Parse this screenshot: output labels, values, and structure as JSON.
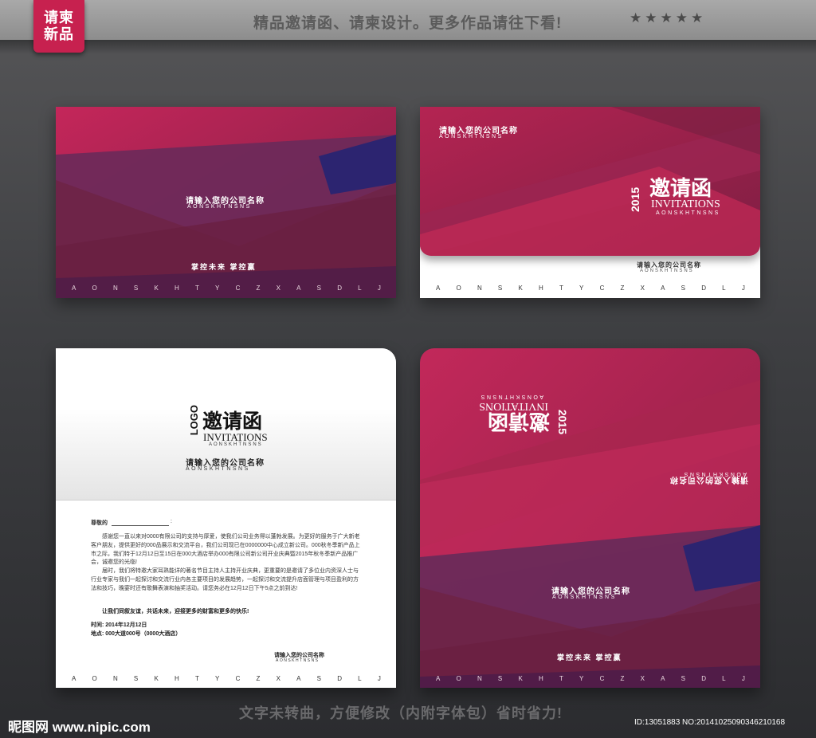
{
  "banner": {
    "badge_line1": "请柬",
    "badge_line2": "新品",
    "headline": "精品邀请函、请柬设计。更多作品请往下看!",
    "stars": "★★★★★"
  },
  "card_front": {
    "company": "请输入您的公司名称",
    "company_en": "AONSKHTNSNS",
    "slogan": "掌控未来  掌控赢",
    "letters": [
      "A",
      "O",
      "N",
      "S",
      "K",
      "H",
      "T",
      "Y",
      "C",
      "Z",
      "X",
      "A",
      "S",
      "D",
      "L",
      "J"
    ]
  },
  "card_back": {
    "company": "请输入您的公司名称",
    "company_en": "AONSKHTNSNS",
    "year": "2015",
    "title_zh": "邀请函",
    "title_en": "INVITATIONS",
    "title_sub": "AONSKHTNSNS",
    "letters": [
      "A",
      "O",
      "N",
      "S",
      "K",
      "H",
      "T",
      "Y",
      "C",
      "Z",
      "X",
      "A",
      "S",
      "D",
      "L",
      "J"
    ]
  },
  "card_inside": {
    "logo": "LOGO",
    "title_zh": "邀请函",
    "title_en": "INVITATIONS",
    "title_sub": "AONSKHTNSNS",
    "company": "请输入您的公司名称",
    "company_en": "AONSKHTNSNS",
    "greeting": "尊敬的",
    "greeting_colon": ":",
    "body_p1": "感谢您一直以来对0000有限公司的支持与厚爱，使我们公司业务得以蓬勃发展。为更好的服务于广大新老客户朋友，提供更好的000品展示和交流平台，我们公司现已在0000000中心成立新公司。000秋冬季新产品上市之际，我们特于12月12日至15日在000大酒店举办000有限公司新公司开业庆典暨2015年秋冬季新产品推广会，诚邀您的光临!",
    "body_p2": "届时，我们将特邀大家耳熟能详的著名节目主持人主持开业庆典，更重要的是邀请了多位业内资深人士与行业专家与我们一起探讨和交流行业内各主要项目的发展趋势，一起探讨和交流提升店面管理与项目盈利的方法和技巧，晚宴时还有歌舞表演和抽奖活动。请您务必在12月12日下午5点之前到达!",
    "closing": "让我们同叙友谊，共话未来，迎接更多的财富和更多的快乐!",
    "time": "时间: 2014年12月12日",
    "place": "地点: 000大道000号（0000大酒店）",
    "signature": "请输入您的公司名称",
    "signature_en": "AONSKHTNSNS",
    "letters": [
      "A",
      "O",
      "N",
      "S",
      "K",
      "H",
      "T",
      "Y",
      "C",
      "Z",
      "X",
      "A",
      "S",
      "D",
      "L",
      "J"
    ]
  },
  "card_open": {
    "year": "2015",
    "title_zh": "邀请函",
    "title_en": "INVITATIONS",
    "title_sub": "AONSKHTNSNS",
    "company_flipped": "请输入您的公司名称",
    "company_en_flipped": "AONSKHTNSNS",
    "company": "请输入您的公司名称",
    "company_en": "AONSKHTNSNS",
    "slogan": "掌控未来  掌控赢",
    "letters": [
      "A",
      "O",
      "N",
      "S",
      "K",
      "H",
      "T",
      "Y",
      "C",
      "Z",
      "X",
      "A",
      "S",
      "D",
      "L",
      "J"
    ]
  },
  "footer": {
    "note": "文字未转曲，方便修改（内附字体包）省时省力!",
    "watermark": "昵图网 www.nipic.com",
    "id_line": "ID:13051883 NO:20141025090346210168"
  },
  "colors": {
    "magenta": "#b3234f",
    "plum": "#5f2a58",
    "indigo": "#2c2470",
    "deep_red": "#8c1d3c"
  }
}
